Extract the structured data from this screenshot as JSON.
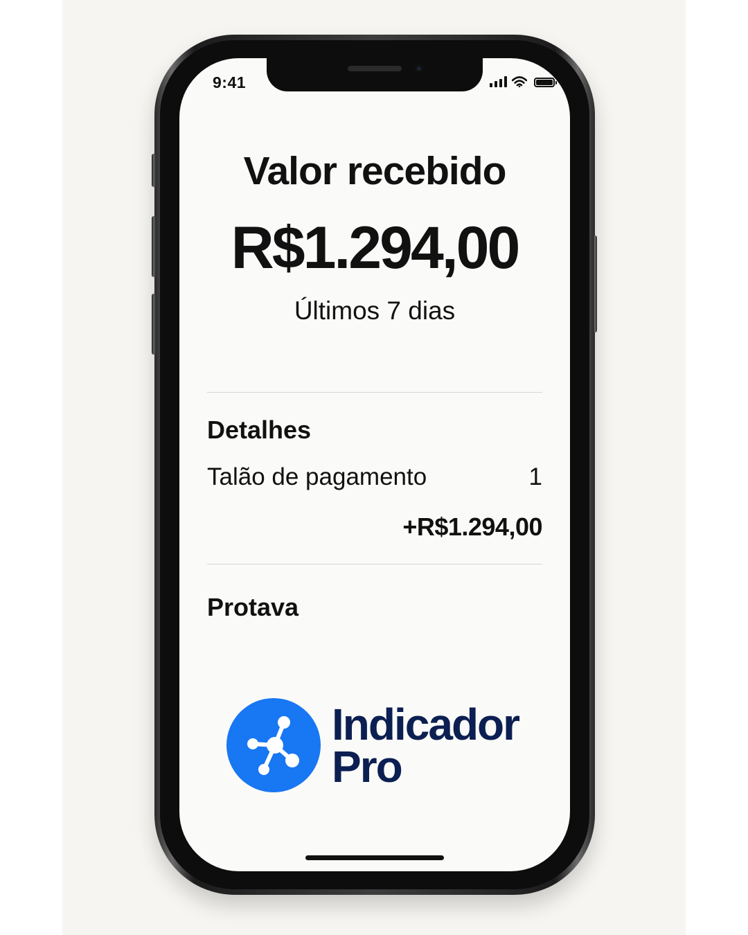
{
  "status_bar": {
    "time": "9:41",
    "icons": [
      "cellular-signal-icon",
      "wifi-icon",
      "battery-icon"
    ]
  },
  "summary": {
    "title": "Valor recebido",
    "amount": "R$1.294,00",
    "period": "Últimos 7 dias"
  },
  "details": {
    "title": "Detalhes",
    "row": {
      "label": "Talão de pagamento",
      "count": "1",
      "value": "+R$1.294,00"
    }
  },
  "source": {
    "title": "Protava"
  },
  "logo": {
    "line1": "Indicador",
    "line2": "Pro",
    "icon": "network-nodes-icon",
    "icon_color": "#1877f2",
    "text_color": "#0c1f52"
  }
}
